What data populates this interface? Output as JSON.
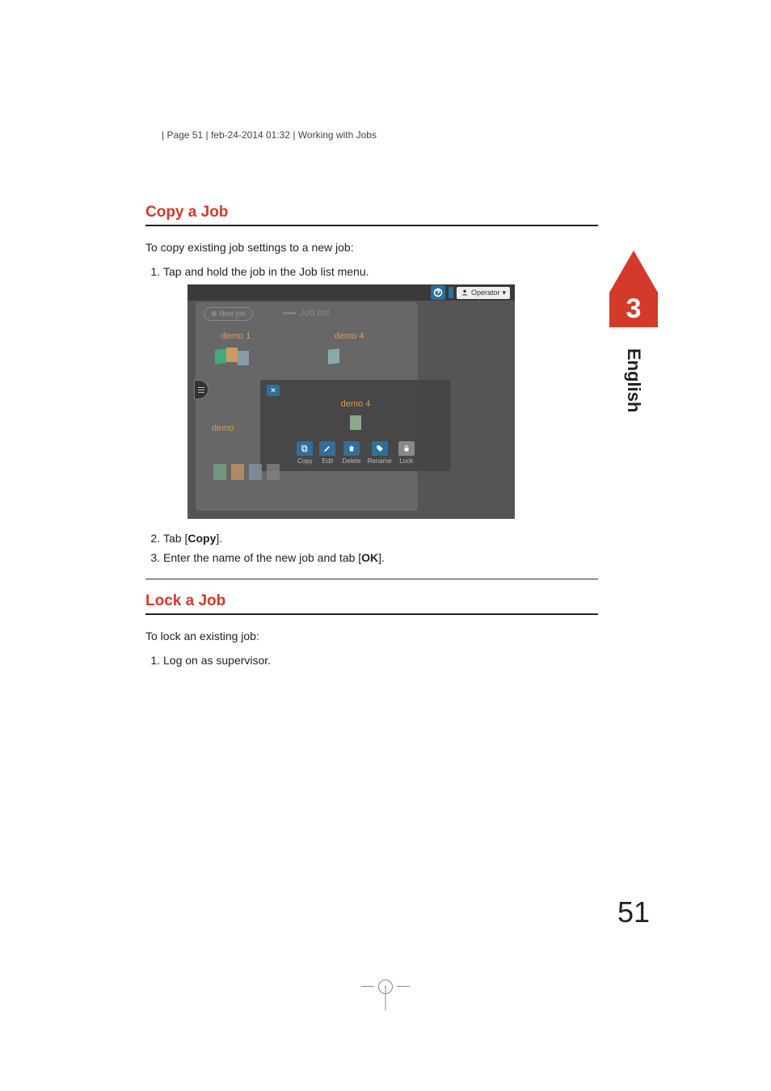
{
  "header": "| Page 51 | feb-24-2014 01:32 | Working with Jobs",
  "chapter_number": "3",
  "language_tab": "English",
  "page_number": "51",
  "section1": {
    "title": "Copy a Job",
    "intro": "To copy existing job settings to a new job:",
    "step1": "Tap and hold the job in the Job list menu.",
    "step2_pre": "Tab [",
    "step2_bold": "Copy",
    "step2_post": "].",
    "step3_pre": "Enter the name of the new job and tab [",
    "step3_bold": "OK",
    "step3_post": "]."
  },
  "section2": {
    "title": "Lock a Job",
    "intro": "To lock an existing job:",
    "step1": "Log on as supervisor."
  },
  "screenshot": {
    "help_icon": "?",
    "user_label": "Operator",
    "new_job": "New job",
    "list_title": "Job list",
    "job1": "demo 1",
    "job4": "demo 4",
    "popup_title": "demo 4",
    "left_label": "demo",
    "actions": {
      "copy": "Copy",
      "edit": "Edit",
      "delete": "Delete",
      "rename": "Rename",
      "lock": "Lock"
    }
  }
}
